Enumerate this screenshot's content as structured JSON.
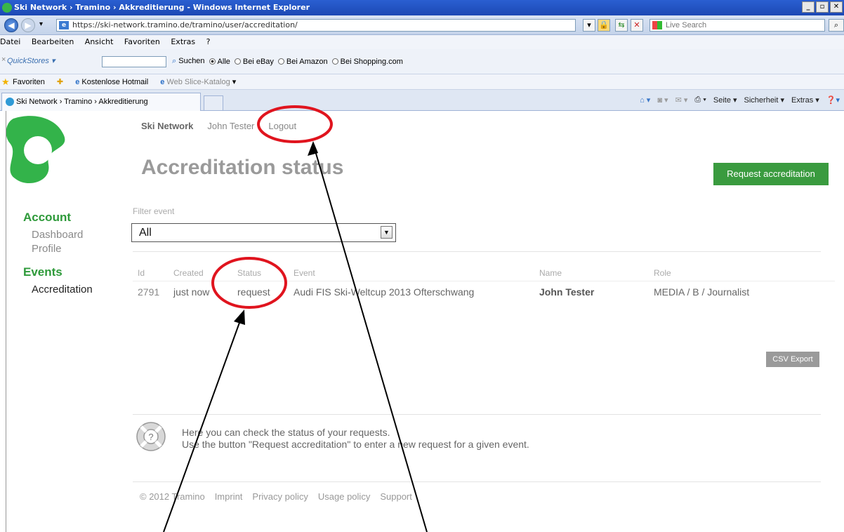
{
  "browser": {
    "window_title": "Ski Network › Tramino › Akkreditierung - Windows Internet Explorer",
    "url": "https://ski-network.tramino.de/tramino/user/accreditation/",
    "live_search_placeholder": "Live Search",
    "menu": [
      "Datei",
      "Bearbeiten",
      "Ansicht",
      "Favoriten",
      "Extras",
      "?"
    ],
    "quickstores": "QuickStores",
    "search_label": "Suchen",
    "search_options": [
      "Alle",
      "Bei eBay",
      "Bei Amazon",
      "Bei Shopping.com"
    ],
    "favorites_label": "Favoriten",
    "fav_items": [
      "Kostenlose Hotmail",
      "Web Slice-Katalog"
    ],
    "tab_title": "Ski Network › Tramino › Akkreditierung",
    "command_bar": [
      "Seite",
      "Sicherheit",
      "Extras"
    ]
  },
  "nav": {
    "brand": "Ski Network",
    "user": "John Tester",
    "logout": "Logout"
  },
  "page_title": "Accreditation status",
  "request_button": "Request accreditation",
  "sidebar": {
    "account_heading": "Account",
    "account_items": [
      "Dashboard",
      "Profile"
    ],
    "events_heading": "Events",
    "events_items": [
      "Accreditation"
    ]
  },
  "filter": {
    "label": "Filter event",
    "selected": "All"
  },
  "table": {
    "headers": [
      "Id",
      "Created",
      "Status",
      "Event",
      "Name",
      "Role"
    ],
    "rows": [
      [
        "2791",
        "just now",
        "request",
        "Audi FIS Ski-Weltcup 2013 Ofterschwang",
        "John Tester",
        "MEDIA / B / Journalist"
      ]
    ]
  },
  "csv_button": "CSV Export",
  "help": {
    "line1": "Here you can check the status of your requests.",
    "line2": "Use the button \"Request accreditation\" to enter a new request for a given event."
  },
  "footer": [
    "© 2012 Tramino",
    "Imprint",
    "Privacy policy",
    "Usage policy",
    "Support"
  ],
  "colors": {
    "accent_green": "#3a9b3f",
    "annotation_red": "#e0141e"
  }
}
